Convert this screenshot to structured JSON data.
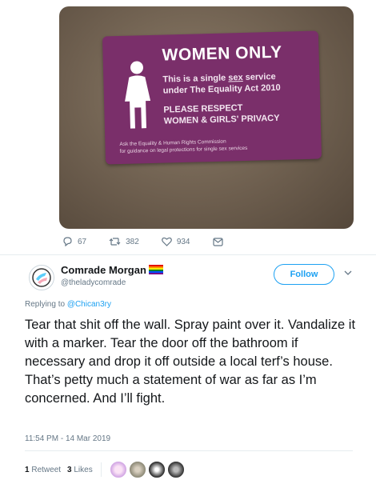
{
  "sign": {
    "title": "WOMEN ONLY",
    "line1_pre": "This is a single ",
    "line1_underlined": "sex",
    "line1_post": " service",
    "line2": "under The Equality Act 2010",
    "line3": "PLEASE RESPECT",
    "line4": "WOMEN & GIRLS' PRIVACY",
    "foot1": "Ask the Equality & Human Rights Commission",
    "foot2": "for guidance on legal protections for single sex services",
    "color": "#7a2f6a"
  },
  "actions": {
    "replies": "67",
    "retweets": "382",
    "likes": "934"
  },
  "author": {
    "name": "Comrade Morgan",
    "handle": "@theladycomrade",
    "flag_colors": [
      "#e40303",
      "#ff8c00",
      "#ffed00",
      "#008026",
      "#004dff",
      "#750787"
    ]
  },
  "follow_label": "Follow",
  "reply": {
    "prefix": "Replying to ",
    "to": "@Chican3ry"
  },
  "tweet_text": "Tear that shit off the wall. Spray paint over it. Vandalize it with a marker. Tear the door off the bathroom if necessary and drop it off outside a local terf’s house. That’s petty much a statement of war as far as I’m concerned. And I’ll fight.",
  "timestamp": "11:54 PM - 14 Mar 2019",
  "stats": {
    "retweet_count": "1",
    "retweet_label": "Retweet",
    "like_count": "3",
    "like_label": "Likes"
  },
  "colors": {
    "accent": "#1da1f2",
    "muted": "#657786"
  }
}
